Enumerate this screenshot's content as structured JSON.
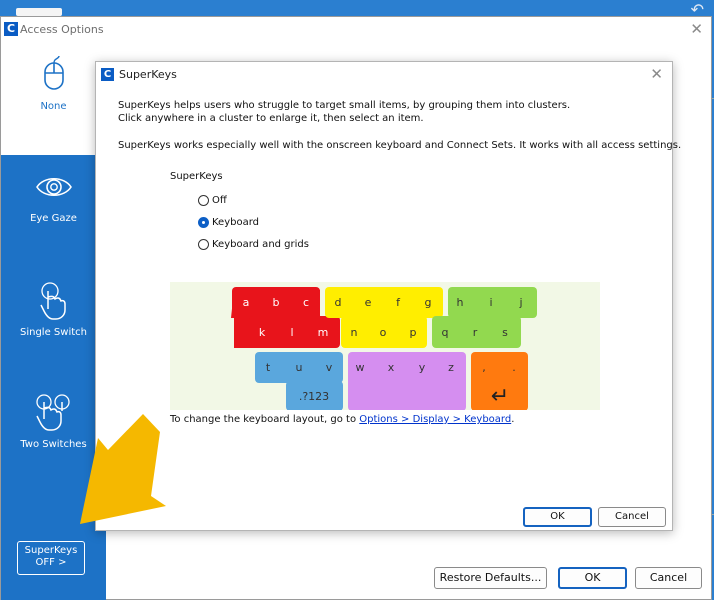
{
  "outer_window": {
    "title": "Access Options",
    "logo_letter": "C"
  },
  "sidebar": {
    "items": [
      {
        "label": "None",
        "icon": "mouse-icon",
        "active": true
      },
      {
        "label": "Eye Gaze",
        "icon": "eye-icon",
        "active": false
      },
      {
        "label": "Single Switch",
        "icon": "single-touch-icon",
        "active": false
      },
      {
        "label": "Two Switches",
        "icon": "two-touch-icon",
        "active": false
      }
    ],
    "superkeys_button": {
      "line1": "SuperKeys",
      "line2": "OFF >"
    }
  },
  "outer_buttons": {
    "restore": "Restore Defaults...",
    "ok": "OK",
    "cancel": "Cancel"
  },
  "dialog": {
    "title": "SuperKeys",
    "logo_letter": "C",
    "intro_line1": "SuperKeys helps users who struggle to target small items, by grouping them into clusters.",
    "intro_line2": "Click anywhere in a cluster to enlarge it, then select an item.",
    "intro_line3": "SuperKeys works especially well with the onscreen keyboard and Connect Sets. It works with all access settings.",
    "group_label": "SuperKeys",
    "options": [
      {
        "label": "Off",
        "selected": false
      },
      {
        "label": "Keyboard",
        "selected": true
      },
      {
        "label": "Keyboard and grids",
        "selected": false
      }
    ],
    "note_prefix": "To change the keyboard layout, go to ",
    "note_link": "Options > Display > Keyboard",
    "note_suffix": ".",
    "ok": "OK",
    "cancel": "Cancel"
  },
  "keyboard": {
    "background": "#f2f8e6",
    "clusters": [
      {
        "color": "#e8141b",
        "rows": [
          [
            "a",
            "b",
            "c"
          ],
          [
            "k",
            "l",
            "m"
          ]
        ]
      },
      {
        "color": "#ffee00",
        "rows": [
          [
            "d",
            "e",
            "f",
            "g"
          ],
          [
            "n",
            "o",
            "p"
          ]
        ]
      },
      {
        "color": "#92d94f",
        "rows": [
          [
            "h",
            "i",
            "j"
          ],
          [
            "q",
            "r",
            "s"
          ]
        ]
      },
      {
        "color": "#5aa7dd",
        "rows": [
          [
            "t",
            "u",
            "v"
          ],
          [
            ".?123"
          ]
        ]
      },
      {
        "color": "#d58ef0",
        "rows": [
          [
            "w",
            "x",
            "y",
            "z"
          ]
        ]
      },
      {
        "color": "#ff7a0f",
        "rows": [
          [
            ",",
            "."
          ],
          [
            "↵"
          ]
        ]
      }
    ]
  },
  "colors": {
    "accent": "#1d72c6",
    "arrow": "#f5b800"
  }
}
